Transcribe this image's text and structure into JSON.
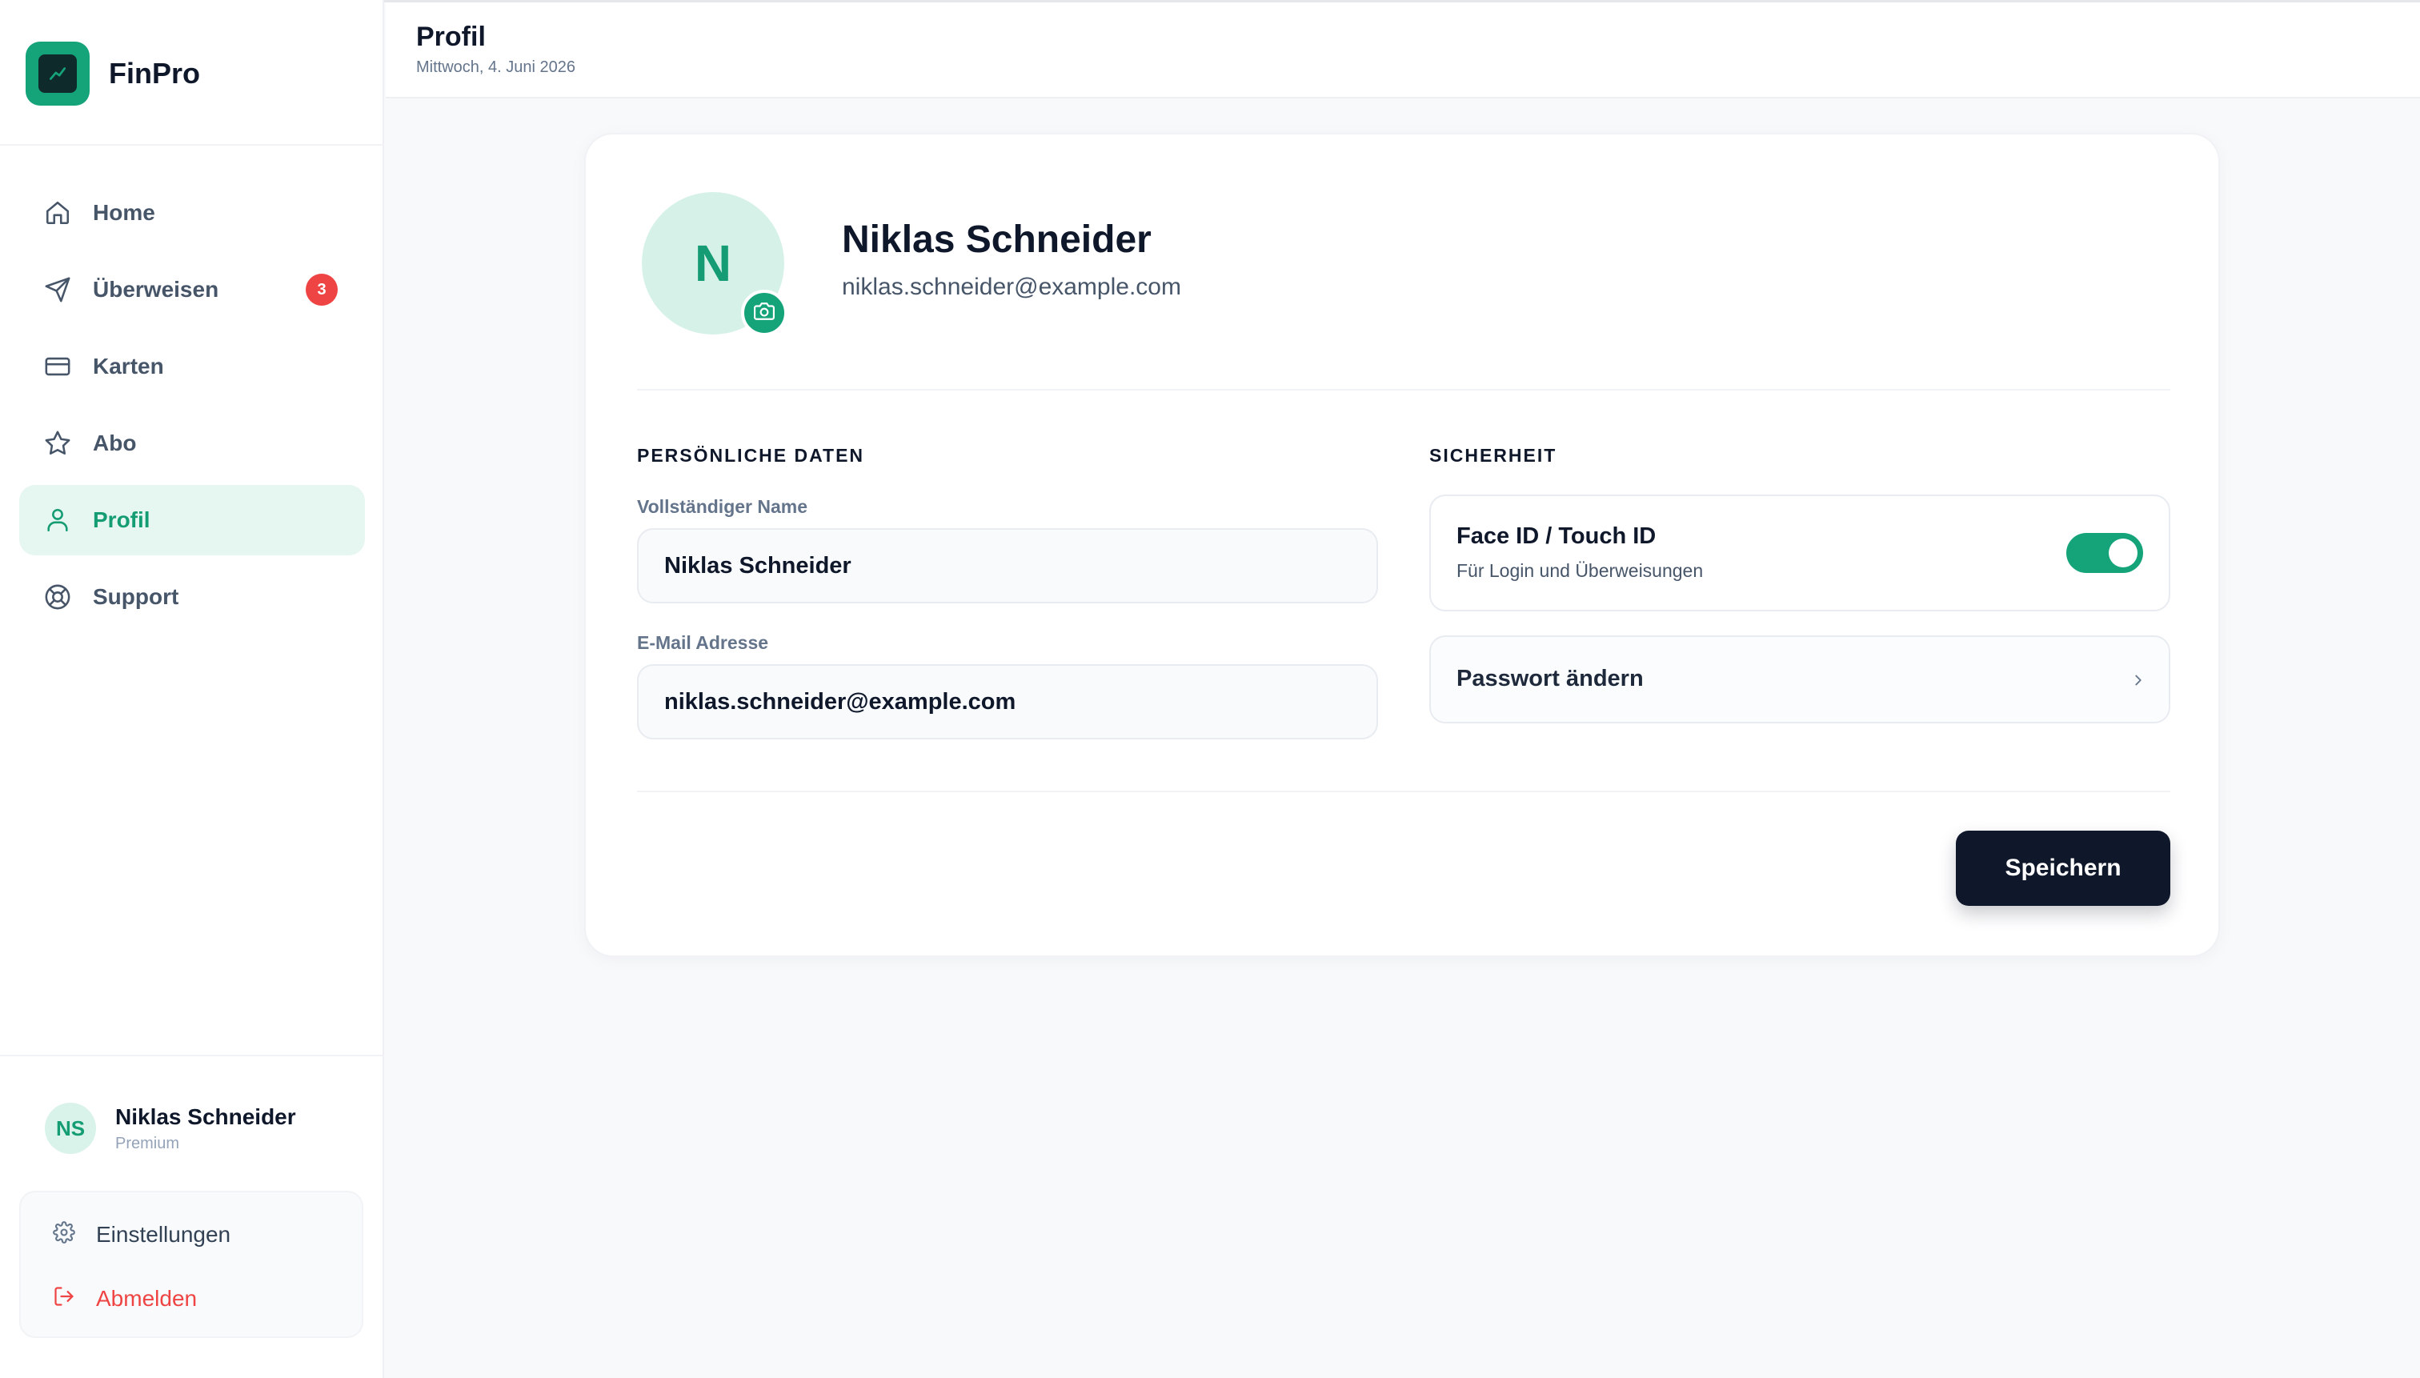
{
  "app": {
    "brand": "FinPro"
  },
  "sidebar": {
    "items": [
      {
        "label": "Home",
        "icon": "home-icon"
      },
      {
        "label": "Überweisen",
        "icon": "send-icon",
        "badge": "3"
      },
      {
        "label": "Karten",
        "icon": "credit-card-icon"
      },
      {
        "label": "Abo",
        "icon": "star-icon"
      },
      {
        "label": "Profil",
        "icon": "user-icon",
        "active": true
      },
      {
        "label": "Support",
        "icon": "lifebuoy-icon"
      }
    ],
    "user": {
      "initials": "NS",
      "name": "Niklas Schneider",
      "plan": "Premium"
    },
    "actions": {
      "settings": "Einstellungen",
      "logout": "Abmelden"
    }
  },
  "header": {
    "title": "Profil",
    "date": "Mittwoch, 4. Juni 2026"
  },
  "profile": {
    "initial": "N",
    "name": "Niklas Schneider",
    "email": "niklas.schneider@example.com"
  },
  "personal": {
    "title": "PERSÖNLICHE DATEN",
    "name_label": "Vollständiger Name",
    "name_value": "Niklas Schneider",
    "email_label": "E-Mail Adresse",
    "email_value": "niklas.schneider@example.com"
  },
  "security": {
    "title": "SICHERHEIT",
    "faceid_title": "Face ID / Touch ID",
    "faceid_sub": "Für Login und Überweisungen",
    "faceid_enabled": true,
    "password_label": "Passwort ändern"
  },
  "actions": {
    "save": "Speichern"
  },
  "colors": {
    "accent": "#15a47a",
    "danger": "#ef4444",
    "dark": "#0f172a"
  }
}
